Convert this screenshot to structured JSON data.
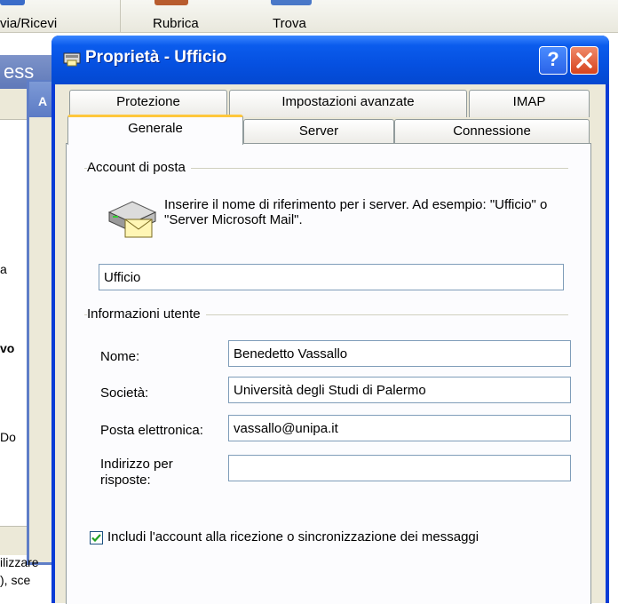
{
  "background": {
    "toolbar_items": [
      "via/Ricevi",
      "Rubrica",
      "Trova"
    ],
    "window_title_fragment": "ess",
    "window2_title_fragment": "A",
    "side_texts": [
      "a",
      "vo",
      "Do",
      "ilizzare",
      "), sce"
    ]
  },
  "dialog": {
    "title": "Proprietà - Ufficio",
    "help_label": "?",
    "close_label": "✕",
    "tabs": {
      "row1": [
        "Protezione",
        "Impostazioni avanzate",
        "IMAP"
      ],
      "row2": [
        "Generale",
        "Server",
        "Connessione"
      ],
      "active": "Generale"
    },
    "account": {
      "group_label": "Account di posta",
      "description": "Inserire il nome di riferimento per i server. Ad esempio: \"Ufficio\" o \"Server Microsoft Mail\".",
      "icon": "mail-server-icon",
      "name_value": "Ufficio"
    },
    "user_info": {
      "group_label": "Informazioni utente",
      "name_label": "Nome:",
      "name_value": "Benedetto Vassallo",
      "company_label": "Società:",
      "company_value": "Università degli Studi di Palermo",
      "email_label": "Posta elettronica:",
      "email_value": "vassallo@unipa.it",
      "reply_label": "Indirizzo per risposte:",
      "reply_value": ""
    },
    "include_checkbox": {
      "label": "Includi l'account alla ricezione o sincronizzazione dei messaggi",
      "checked": true
    }
  }
}
